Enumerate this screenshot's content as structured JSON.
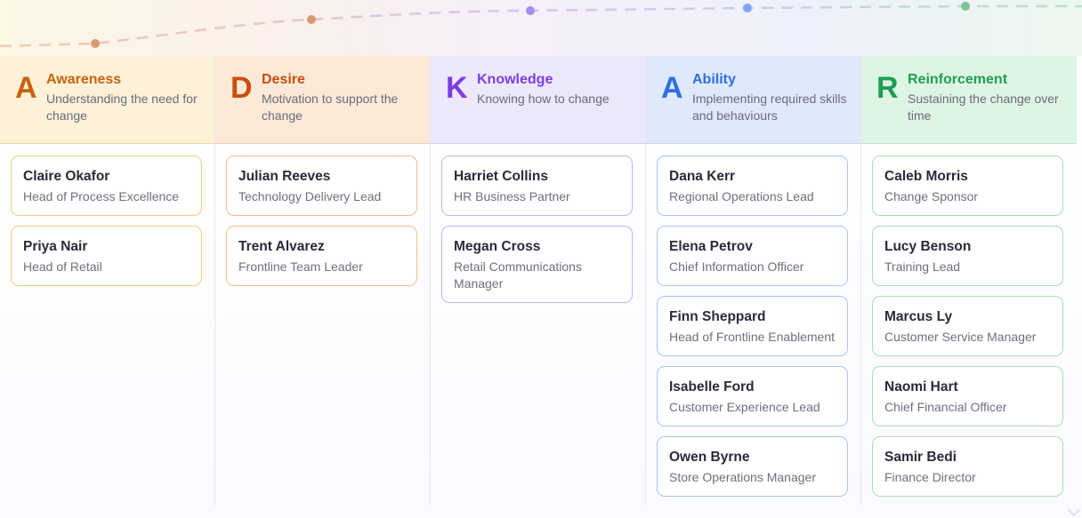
{
  "colors": {
    "awareness": "#c8630e",
    "desire": "#c94f0e",
    "knowledge": "#7b3fe0",
    "ability": "#2f6fe0",
    "reinforcement": "#1f9f55"
  },
  "columns": [
    {
      "key": "awareness",
      "letter": "A",
      "title": "Awareness",
      "description": "Understanding the need for change",
      "header_bg": "#fdf1d8",
      "header_border": "#efd89a",
      "card_border": "#f1cd7c",
      "people": [
        {
          "name": "Claire Okafor",
          "role": "Head of Process Excellence"
        },
        {
          "name": "Priya Nair",
          "role": "Head of Retail"
        }
      ]
    },
    {
      "key": "desire",
      "letter": "D",
      "title": "Desire",
      "description": "Motivation to support the change",
      "header_bg": "#fde9d8",
      "header_border": "#f2cfb0",
      "card_border": "#f4bd8c",
      "people": [
        {
          "name": "Julian Reeves",
          "role": "Technology Delivery Lead"
        },
        {
          "name": "Trent Alvarez",
          "role": "Frontline Team Leader"
        }
      ]
    },
    {
      "key": "knowledge",
      "letter": "K",
      "title": "Knowledge",
      "description": "Knowing how to change",
      "header_bg": "#ede8fc",
      "header_border": "#d8cff5",
      "card_border": "#c3b3f1",
      "people": [
        {
          "name": "Harriet Collins",
          "role": "HR Business Partner"
        },
        {
          "name": "Megan Cross",
          "role": "Retail Communications Manager"
        }
      ]
    },
    {
      "key": "ability",
      "letter": "A",
      "title": "Ability",
      "description": "Implementing required skills and behaviours",
      "header_bg": "#dfe9fc",
      "header_border": "#c5d6f5",
      "card_border": "#a9c3f2",
      "people": [
        {
          "name": "Dana Kerr",
          "role": "Regional Operations Lead"
        },
        {
          "name": "Elena Petrov",
          "role": "Chief Information Officer"
        },
        {
          "name": "Finn Sheppard",
          "role": "Head of Frontline Enablement"
        },
        {
          "name": "Isabelle Ford",
          "role": "Customer Experience Lead"
        },
        {
          "name": "Owen Byrne",
          "role": "Store Operations Manager"
        }
      ]
    },
    {
      "key": "reinforcement",
      "letter": "R",
      "title": "Reinforcement",
      "description": "Sustaining the change over time",
      "header_bg": "#def5e4",
      "header_border": "#bfe6cb",
      "card_border": "#a6dfb7",
      "people": [
        {
          "name": "Caleb Morris",
          "role": "Change Sponsor"
        },
        {
          "name": "Lucy Benson",
          "role": "Training Lead"
        },
        {
          "name": "Marcus Ly",
          "role": "Customer Service Manager"
        },
        {
          "name": "Naomi Hart",
          "role": "Chief Financial Officer"
        },
        {
          "name": "Samir Bedi",
          "role": "Finance Director"
        }
      ]
    }
  ],
  "progress_path": {
    "dot_colors": [
      "#d99a72",
      "#d99a72",
      "#a98de8",
      "#7ea6ee",
      "#7dc597"
    ]
  }
}
